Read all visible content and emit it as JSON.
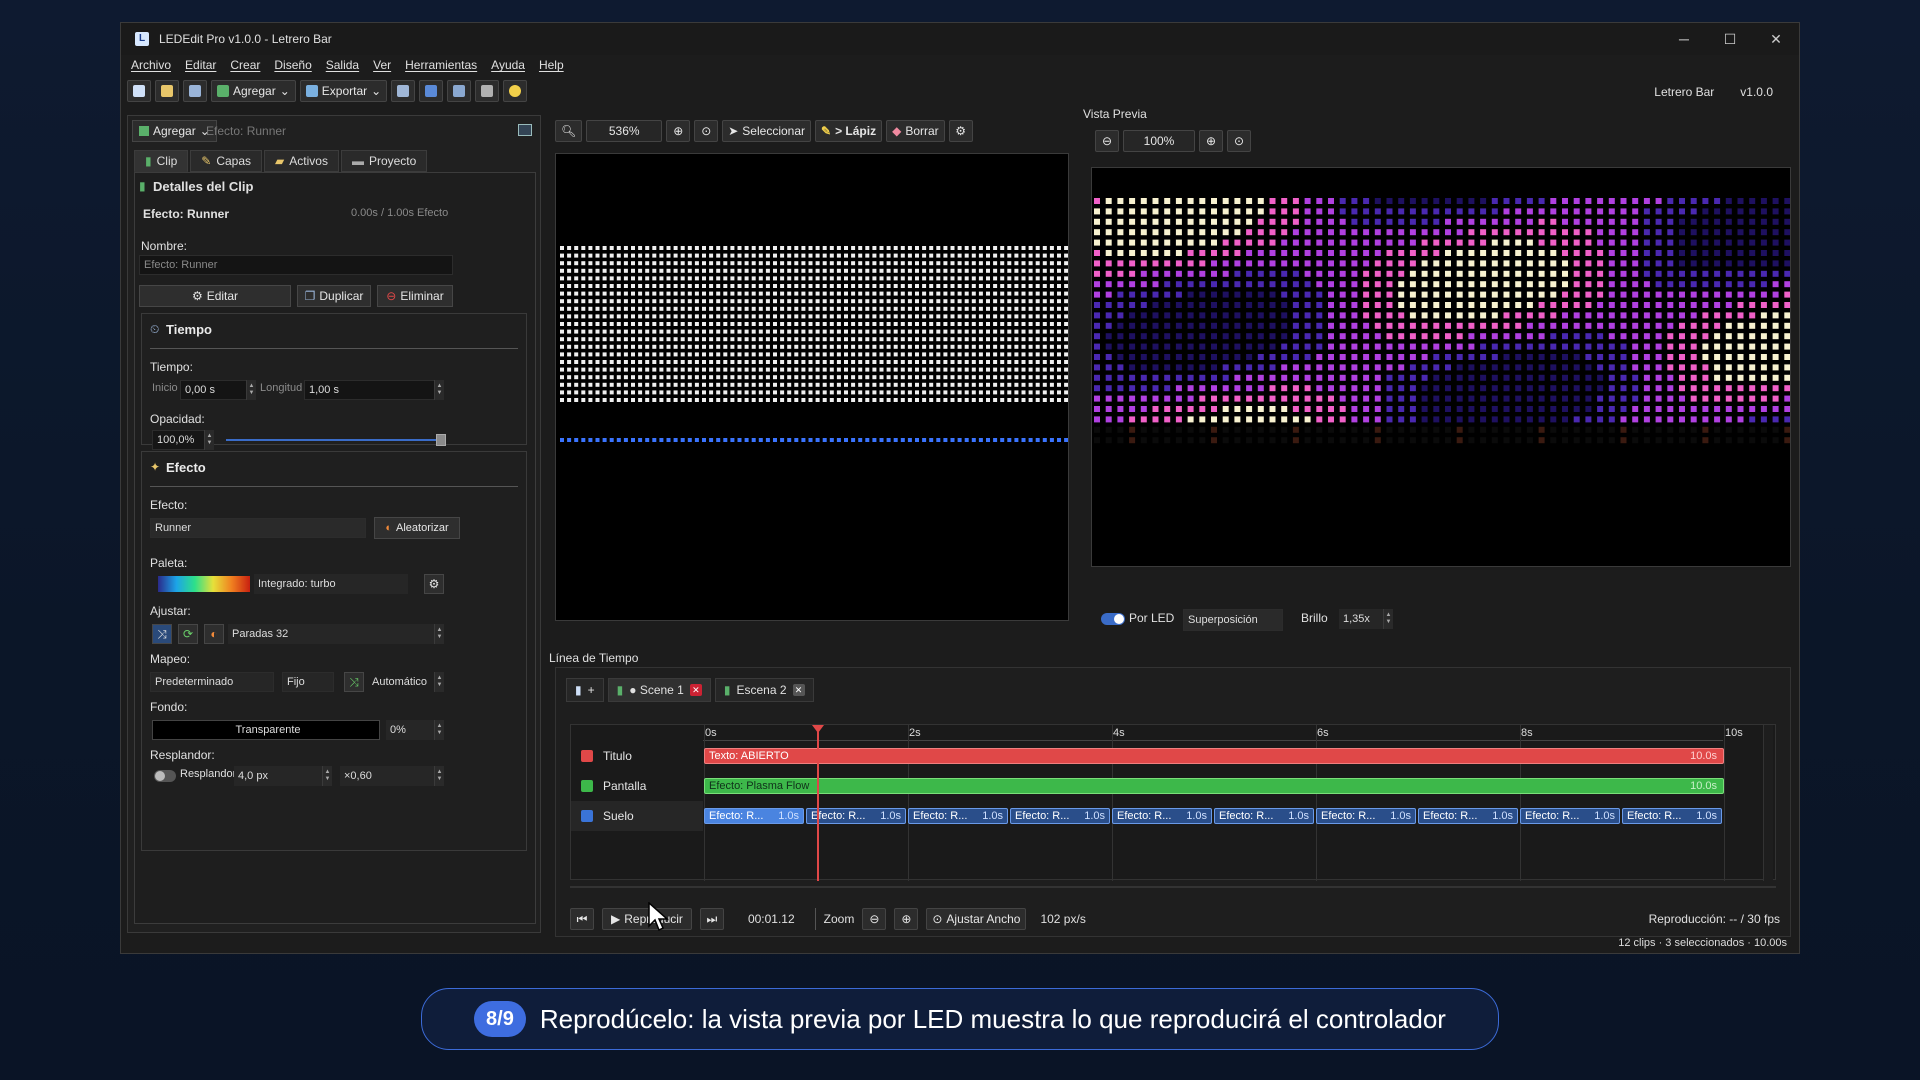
{
  "window": {
    "title": "LEDEdit Pro v1.0.0 - Letrero Bar"
  },
  "menu": [
    "Archivo",
    "Editar",
    "Crear",
    "Diseño",
    "Salida",
    "Ver",
    "Herramientas",
    "Ayuda",
    "Help"
  ],
  "toolbar": {
    "agregar": "Agregar",
    "exportar": "Exportar",
    "project": "Letrero Bar",
    "version": "v1.0.0"
  },
  "left": {
    "agregar": "Agregar",
    "header_effect": "Efecto: Runner",
    "tabs": [
      "Clip",
      "Capas",
      "Activos",
      "Proyecto"
    ],
    "details_title": "Detalles del Clip",
    "clip_effect": "Efecto: Runner",
    "clip_time": "0.00s / 1.00s",
    "clip_type": "Efecto",
    "name_label": "Nombre:",
    "name_placeholder": "Efecto: Runner",
    "edit": "Editar",
    "duplicate": "Duplicar",
    "delete": "Eliminar",
    "tiempo_title": "Tiempo",
    "tiempo_label": "Tiempo:",
    "inicio_label": "Inicio",
    "inicio_value": "0,00 s",
    "longitud_label": "Longitud",
    "longitud_value": "1,00 s",
    "opacidad_label": "Opacidad:",
    "opacidad_value": "100,0%",
    "opacidad_level": 1.0,
    "efecto_title": "Efecto",
    "efecto_label": "Efecto:",
    "efecto_value": "Runner",
    "aleatorizar": "Aleatorizar",
    "paleta_label": "Paleta:",
    "paleta_value": "Integrado: turbo",
    "ajustar_label": "Ajustar:",
    "paradas": "Paradas 32",
    "mapeo_label": "Mapeo:",
    "mapeo_value": "Predeterminado",
    "fijo": "Fijo",
    "auto": "Automático",
    "fondo_label": "Fondo:",
    "fondo_value": "Transparente",
    "fondo_pct": "0%",
    "resplandor_label": "Resplandor:",
    "resplandor_toggle": "Resplandor",
    "resplandor_px": "4,0 px",
    "resplandor_mult": "×0,60"
  },
  "center": {
    "zoom": "536%",
    "select": "Seleccionar",
    "pencil": "> Lápiz",
    "erase": "Borrar"
  },
  "preview": {
    "title": "Vista Previa",
    "zoom": "100%",
    "por_led": "Por LED",
    "overlay": "Superposición",
    "brillo_label": "Brillo",
    "brillo_value": "1,35x"
  },
  "timeline": {
    "title": "Línea de Tiempo",
    "add": "+",
    "tabs": [
      "● Scene 1",
      "Escena 2"
    ],
    "ruler": [
      "0s",
      "2s",
      "4s",
      "6s",
      "8s",
      "10s"
    ],
    "tracks": [
      {
        "name": "Titulo",
        "color": "#e04848",
        "clip": "Texto: ABIERTO",
        "dur": "10.0s"
      },
      {
        "name": "Pantalla",
        "color": "#3db84a",
        "clip": "Efecto: Plasma Flow",
        "dur": "10.0s"
      },
      {
        "name": "Suelo",
        "color": "#3a74d8",
        "clip": "Efecto: R...",
        "dur": "1.0s"
      }
    ],
    "play": "Reproducir",
    "time": "00:01.12",
    "zoom_label": "Zoom",
    "fit": "Ajustar Ancho",
    "pxs": "102 px/s",
    "playback": "Reproducción: -- / 30 fps"
  },
  "status": "12 clips  ·  3 seleccionados  ·  10.00s",
  "banner": {
    "step": "8/9",
    "text": "Reprodúcelo: la vista previa por LED muestra lo que reproducirá el controlador"
  }
}
